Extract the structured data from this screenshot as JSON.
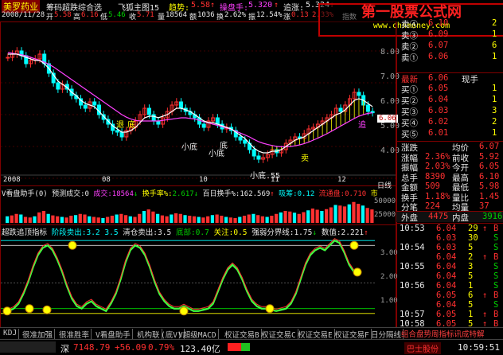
{
  "header": {
    "stock_name": "美罗药业",
    "formula_label": "筹码超跌综合选",
    "chart_label": "飞狐主图15",
    "trend_label": "趋势:",
    "trend_value": "5.58",
    "trend_arrow": "↑",
    "operation_label": "操盘手:",
    "operation_value": "5.320",
    "operation_arrow": "↑",
    "chase_label": "追涨:",
    "chase_value": "5.324",
    "chase_arrow": "↑"
  },
  "price_info": {
    "date": "2008/11/28",
    "open_label": "开",
    "open": "5.58",
    "high_label": "高",
    "high": "6.16",
    "low_label": "低",
    "low": "5.46",
    "close_label": "收",
    "close": "5.71",
    "volume_label": "量",
    "volume": "18564",
    "amount_label": "额",
    "amount": "1036",
    "turnover_label": "换",
    "turnover": "2.62%",
    "range_label": "振",
    "range": "12.54%",
    "change_label": "涨",
    "change": "0.13",
    "change_pct": "2.33%",
    "index_label": "指数"
  },
  "main_chart": {
    "y_ticks": [
      "8.00",
      "7.00",
      "6.00",
      "5.00",
      "4.00"
    ],
    "current_price": "6.06",
    "x_label_left": "2008",
    "x_ticks": [
      "08",
      "10",
      "11",
      "12"
    ],
    "annotations": [
      "退",
      "底",
      "小底",
      "底",
      "小底",
      "小底.55",
      "卖",
      "追",
      "追"
    ],
    "closes": [
      7.8,
      7.9,
      8.0,
      7.85,
      7.6,
      7.7,
      7.75,
      7.9,
      7.6,
      7.3,
      7.0,
      6.8,
      6.95,
      6.8,
      6.6,
      6.5,
      6.3,
      6.2,
      6.4,
      6.3,
      6.0,
      5.85,
      5.7,
      5.5,
      5.45,
      5.3,
      5.5,
      5.6,
      5.8,
      6.0,
      6.2,
      6.0,
      5.8,
      5.7,
      5.9,
      6.1,
      6.3,
      6.4,
      6.2,
      6.1,
      6.0,
      5.9,
      5.7,
      5.6,
      5.8,
      5.9,
      5.7,
      5.55,
      5.6,
      5.5,
      5.3,
      5.2,
      5.1,
      4.9,
      4.7,
      4.6,
      4.65,
      4.75,
      4.9,
      4.8,
      4.9,
      5.1,
      5.2,
      5.3,
      5.25,
      5.4,
      5.55,
      5.6,
      5.7,
      5.8,
      5.9,
      6.0,
      6.2,
      6.1,
      6.3,
      6.5,
      6.7,
      6.6,
      6.3,
      6.1,
      6.06
    ],
    "ma_fast": [
      7.9,
      7.9,
      7.9,
      7.85,
      7.8,
      7.75,
      7.7,
      7.7,
      7.6,
      7.45,
      7.25,
      7.05,
      6.95,
      6.85,
      6.7,
      6.6,
      6.45,
      6.35,
      6.3,
      6.25,
      6.1,
      5.95,
      5.8,
      5.65,
      5.55,
      5.45,
      5.45,
      5.5,
      5.6,
      5.75,
      5.9,
      5.95,
      5.95,
      5.9,
      5.95,
      6.0,
      6.1,
      6.2,
      6.2,
      6.15,
      6.1,
      6.0,
      5.9,
      5.8,
      5.75,
      5.75,
      5.7,
      5.65,
      5.6,
      5.55,
      5.45,
      5.35,
      5.25,
      5.1,
      4.95,
      4.85,
      4.8,
      4.8,
      4.85,
      4.85,
      4.9,
      5.0,
      5.1,
      5.2,
      5.25,
      5.3,
      5.4,
      5.5,
      5.6,
      5.7,
      5.8,
      5.9,
      6.0,
      6.05,
      6.15,
      6.3,
      6.45,
      6.5,
      6.45,
      6.35,
      6.25
    ],
    "ma_slow": [
      7.95,
      7.93,
      7.9,
      7.88,
      7.85,
      7.8,
      7.75,
      7.7,
      7.65,
      7.58,
      7.5,
      7.4,
      7.3,
      7.2,
      7.1,
      7.0,
      6.9,
      6.8,
      6.7,
      6.6,
      6.5,
      6.4,
      6.3,
      6.2,
      6.1,
      6.0,
      5.92,
      5.86,
      5.82,
      5.8,
      5.8,
      5.8,
      5.8,
      5.8,
      5.82,
      5.84,
      5.86,
      5.88,
      5.9,
      5.9,
      5.88,
      5.86,
      5.82,
      5.78,
      5.74,
      5.7,
      5.66,
      5.62,
      5.58,
      5.54,
      5.48,
      5.42,
      5.36,
      5.3,
      5.22,
      5.15,
      5.1,
      5.06,
      5.03,
      5.0,
      4.99,
      4.99,
      5.0,
      5.02,
      5.05,
      5.09,
      5.14,
      5.2,
      5.26,
      5.33,
      5.4,
      5.48,
      5.56,
      5.64,
      5.72,
      5.8,
      5.88,
      5.95,
      6.0,
      6.04,
      6.06
    ]
  },
  "volume_panel": {
    "indicator_name": "V看盘助手(0)",
    "forecast_label": "预测成交:0",
    "volume_label": "成交:",
    "volume_value": "18564",
    "volume_arrow": "↓",
    "turnover_label": "换手率%:",
    "turnover_value": "2.617",
    "turnover_arrow": "↓",
    "hundred_day_label": "百日换手%:",
    "hundred_day_value": "162.569",
    "hundred_day_arrow": "↑",
    "inflow_label": "吸筹:",
    "inflow_value": "0.12",
    "market_label": "流通盘:",
    "market_value": "0.710",
    "market_suffix": "市",
    "y_ticks": [
      "50000",
      "25000"
    ],
    "unit_label": "日线",
    "bars": [
      22,
      25,
      30,
      28,
      20,
      18,
      22,
      35,
      40,
      30,
      25,
      22,
      20,
      18,
      24,
      26,
      30,
      28,
      22,
      20,
      18,
      16,
      20,
      24,
      28,
      30,
      26,
      22,
      20,
      30,
      40,
      45,
      38,
      30,
      25,
      22,
      28,
      32,
      30,
      26,
      24,
      22,
      20,
      18,
      22,
      26,
      28,
      24,
      20,
      18,
      16,
      20,
      24,
      28,
      30,
      26,
      22,
      20,
      24,
      30,
      35,
      40,
      38,
      34,
      30,
      36,
      42,
      48,
      44,
      40,
      46,
      52,
      60,
      58,
      55,
      62,
      70,
      64,
      58,
      50,
      45
    ]
  },
  "osc_panel": {
    "indicator_name": "超跌追顶指标",
    "stage_label": "阶段卖出:",
    "stage_value": "3.2",
    "stage_value2": "3.5",
    "clear_label": "清仓卖出:",
    "clear_value": "3.5",
    "bottom_label": "底部:",
    "bottom_value": "0.7",
    "focus_label": "关注:",
    "focus_value": "0.5",
    "strong_label": "强弱分界线:",
    "strong_value": "1.75",
    "strong_arrow": "↓",
    "value_label": "数值:",
    "value_value": "2.221",
    "value_arrow": "↑",
    "y_ticks": [
      "3.00",
      "2.00",
      "1.00"
    ],
    "values": [
      0.6,
      0.7,
      0.9,
      1.3,
      1.8,
      2.4,
      2.9,
      3.2,
      3.3,
      3.1,
      2.7,
      2.2,
      1.6,
      1.1,
      0.8,
      0.7,
      0.9,
      1.0,
      0.8,
      0.7,
      0.6,
      0.9,
      1.3,
      1.9,
      2.6,
      3.1,
      3.3,
      3.2,
      2.9,
      2.4,
      1.8,
      1.3,
      1.0,
      0.8,
      0.7,
      0.7,
      0.8,
      0.7,
      0.6,
      0.6,
      0.65,
      0.7,
      0.9,
      1.4,
      1.9,
      2.3,
      2.5,
      2.3,
      1.9,
      1.4,
      1.0,
      0.8,
      0.7,
      0.7,
      0.65,
      0.6,
      0.65,
      0.7,
      0.9,
      1.3,
      1.9,
      2.5,
      2.9,
      3.1,
      3.2,
      3.1,
      3.3,
      3.5,
      3.4,
      3.0,
      2.5,
      2.2
    ]
  },
  "quote_panel": {
    "sell_rows": [
      {
        "label": "卖④",
        "price": "6.10",
        "vol": "2"
      },
      {
        "label": "卖③",
        "price": "6.09",
        "vol": "1"
      },
      {
        "label": "卖②",
        "price": "6.07",
        "vol": "6"
      },
      {
        "label": "卖①",
        "price": "6.06",
        "vol": "1"
      }
    ],
    "latest_label": "最新",
    "latest_value": "6.06",
    "latest_tag": "现手",
    "buy_rows": [
      {
        "label": "买①",
        "price": "6.05",
        "vol": "1"
      },
      {
        "label": "买②",
        "price": "6.04",
        "vol": "1"
      },
      {
        "label": "买③",
        "price": "6.03",
        "vol": "3"
      },
      {
        "label": "买④",
        "price": "6.02",
        "vol": "2"
      },
      {
        "label": "买⑤",
        "price": "6.01",
        "vol": "1"
      }
    ],
    "stats": [
      {
        "l1": "涨跌",
        "v1": "",
        "l2": "均价",
        "v2": "6.07"
      },
      {
        "l1": "涨幅",
        "v1": "2.36%",
        "l2": "前收",
        "v2": "5.92"
      },
      {
        "l1": "振幅",
        "v1": "2.03%",
        "l2": "今开",
        "v2": "6.05"
      },
      {
        "l1": "总手",
        "v1": "8390",
        "l2": "最高",
        "v2": "6.10"
      },
      {
        "l1": "金额",
        "v1": "509",
        "l2": "最低",
        "v2": "5.98"
      },
      {
        "l1": "换手",
        "v1": "1.18%",
        "l2": "量比",
        "v2": "1.45"
      },
      {
        "l1": "分笔",
        "v1": "224",
        "l2": "均量",
        "v2": "37"
      }
    ],
    "outer_label": "外盘",
    "outer_value": "4475",
    "inner_label": "内盘",
    "inner_value": "3916",
    "ticks": [
      {
        "time": "10:53",
        "price": "6.04",
        "vol": "29",
        "dir": "B"
      },
      {
        "time": "",
        "price": "6.03",
        "vol": "30",
        "dir": "S"
      },
      {
        "time": "10:54",
        "price": "6.03",
        "vol": "5",
        "dir": "S"
      },
      {
        "time": "",
        "price": "6.04",
        "vol": "2",
        "dir": "B"
      },
      {
        "time": "10:55",
        "price": "6.04",
        "vol": "3",
        "dir": "S"
      },
      {
        "time": "",
        "price": "6.04",
        "vol": "5",
        "dir": "S"
      },
      {
        "time": "10:56",
        "price": "6.04",
        "vol": "1",
        "dir": "S"
      },
      {
        "time": "",
        "price": "6.05",
        "vol": "6",
        "dir": "B"
      },
      {
        "time": "",
        "price": "6.04",
        "vol": "5",
        "dir": "S"
      },
      {
        "time": "10:57",
        "price": "6.05",
        "vol": "1",
        "dir": "B"
      },
      {
        "time": "10:58",
        "price": "6.05",
        "vol": "5",
        "dir": "B"
      },
      {
        "time": "",
        "price": "6.06",
        "vol": "1",
        "dir": "B"
      }
    ]
  },
  "tabs": [
    "KDJ",
    "很准加强",
    "很准胜率",
    "V看盘助手",
    "机构联",
    "(底V)",
    "V超级MACD",
    "权证交易B",
    "权证交易C",
    "权证交易E",
    "权证交易F",
    "日分隔线",
    "超跌追顶指标"
  ],
  "bottom_text": "组合盘势周指标讯成特解",
  "watermark": {
    "line1": "第一股票公式网",
    "line2": "www.chnmoney.com"
  },
  "statusbar": {
    "market": "深",
    "index_value": "7148.79",
    "index_change": "+56.09",
    "index_pct": "0.79%",
    "amount": "123.40亿",
    "stock_name": "巴士股份",
    "clock": "10:59:51"
  },
  "colors": {
    "up": "#ff3030",
    "down": "#00d000",
    "ma_fast": "#ffffff",
    "ma_slow": "#ff40ff",
    "panel_border": "#800000",
    "osc": "#30ff30"
  }
}
